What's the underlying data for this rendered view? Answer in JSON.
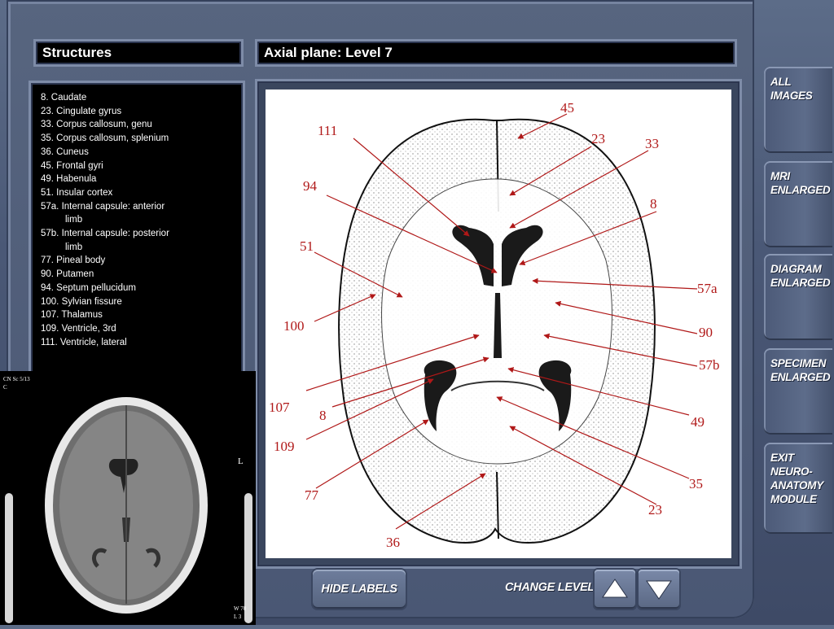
{
  "structures": {
    "title": "Structures",
    "items": [
      {
        "line": "8.  Caudate"
      },
      {
        "line": "23.  Cingulate gyrus"
      },
      {
        "line": "33.  Corpus callosum, genu"
      },
      {
        "line": "35.  Corpus callosum, splenium"
      },
      {
        "line": "36.  Cuneus"
      },
      {
        "line": "45.  Frontal gyri"
      },
      {
        "line": "49.  Habenula"
      },
      {
        "line": "51.  Insular cortex"
      },
      {
        "line": "57a.  Internal capsule: anterior",
        "cont": "limb"
      },
      {
        "line": "57b.  Internal capsule: posterior",
        "cont": "limb"
      },
      {
        "line": "77.  Pineal body"
      },
      {
        "line": "90.  Putamen"
      },
      {
        "line": "94.  Septum pellucidum"
      },
      {
        "line": "100.  Sylvian fissure"
      },
      {
        "line": "107.  Thalamus"
      },
      {
        "line": "109.  Ventricle, 3rd"
      },
      {
        "line": "111.  Ventricle, lateral"
      }
    ]
  },
  "plane_title": "Axial plane: Level 7",
  "diagram": {
    "labels": [
      "45",
      "111",
      "23",
      "33",
      "94",
      "8",
      "51",
      "57a",
      "100",
      "90",
      "57b",
      "107",
      "8",
      "49",
      "109",
      "77",
      "35",
      "23",
      "36"
    ]
  },
  "ct_image": {
    "overlay_top": "CN Sc 5/13",
    "overlay_top2": "C",
    "side_marker": "L",
    "overlay_bottom": "W 70",
    "overlay_bottom2": "L 3"
  },
  "nav_tabs": [
    {
      "label": "ALL IMAGES",
      "icon": "none"
    },
    {
      "label": "MRI\nENLARGED",
      "icon": "none"
    },
    {
      "label": "DIAGRAM\nENLARGED",
      "icon": "none"
    },
    {
      "label": "SPECIMEN\nENLARGED",
      "icon": "none"
    },
    {
      "label": "EXIT\nNEURO-\nANATOMY\nMODULE",
      "icon": "none"
    }
  ],
  "controls": {
    "hide_labels": "HIDE LABELS",
    "change_level": "CHANGE LEVEL",
    "up_icon": "up-arrow-icon",
    "down_icon": "down-arrow-icon"
  },
  "colors": {
    "label_red": "#b01818",
    "frame": "#4f5c78",
    "panel_black": "#000000"
  }
}
